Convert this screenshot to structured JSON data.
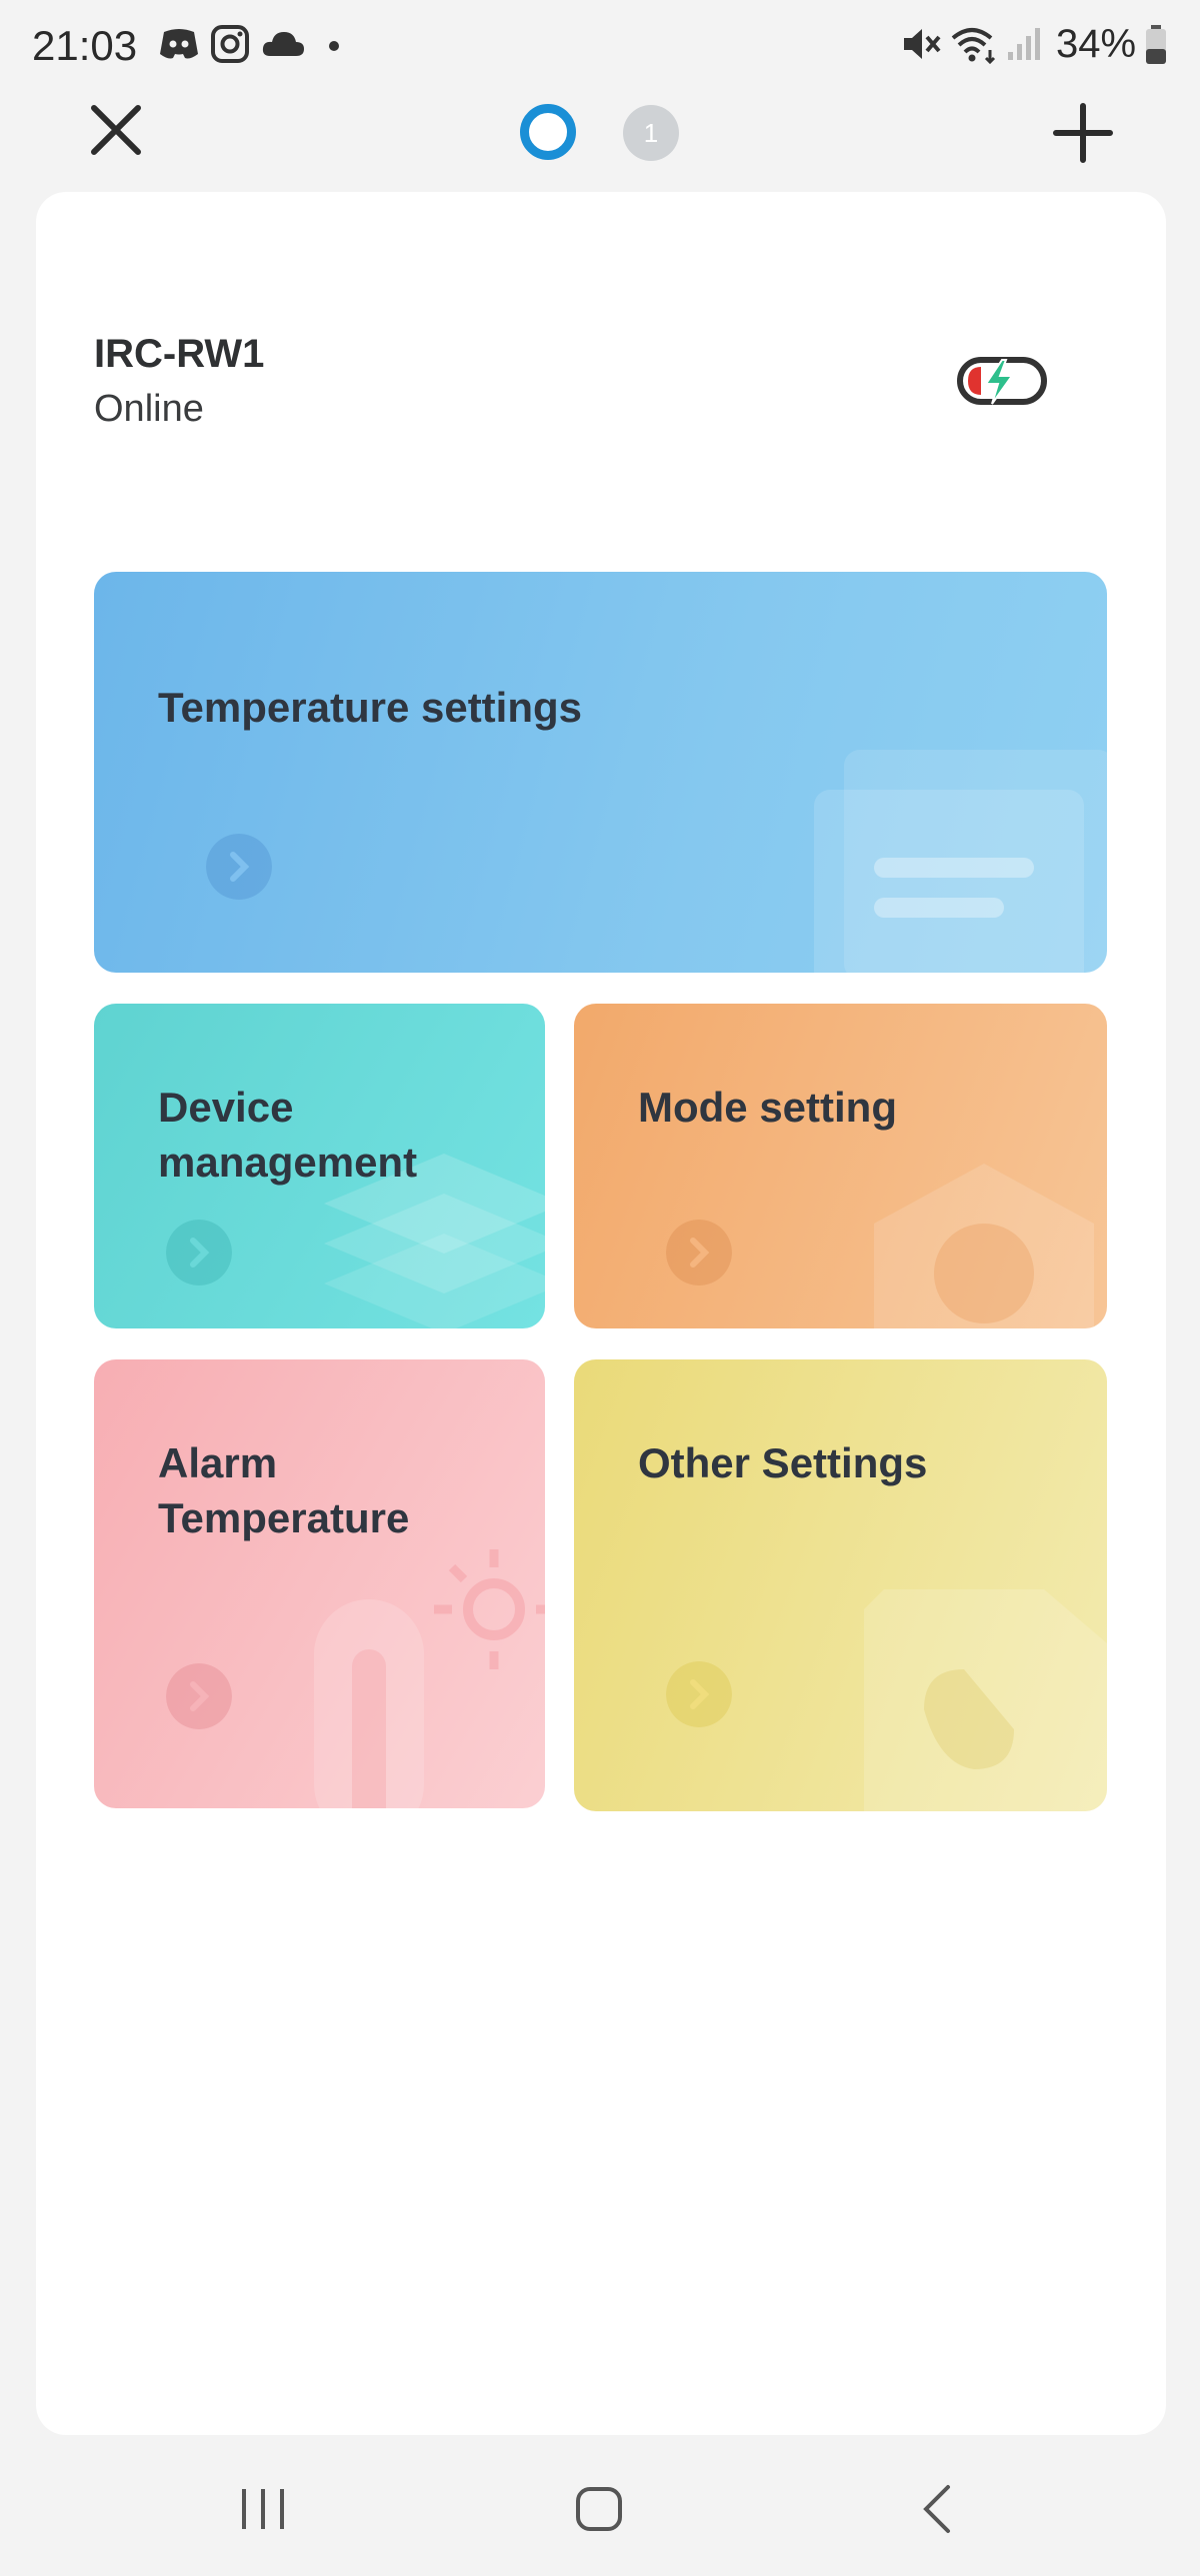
{
  "status_bar": {
    "time": "21:03",
    "battery_percent": "34%",
    "icons": [
      "discord-icon",
      "instagram-icon",
      "cloud-icon",
      "notification-dot-icon",
      "mute-icon",
      "wifi-icon",
      "signal-icon",
      "battery-icon"
    ]
  },
  "header": {
    "page_indicator_badge": "1"
  },
  "device": {
    "name": "IRC-RW1",
    "status": "Online"
  },
  "tiles": [
    {
      "label": "Temperature settings",
      "color": "#6cb6ea"
    },
    {
      "label": "Device management",
      "color": "#5fd3d1"
    },
    {
      "label": "Mode setting",
      "color": "#f2a96b"
    },
    {
      "label": "Alarm Temperature",
      "color": "#f7aeb3"
    },
    {
      "label": "Other Settings",
      "color": "#eada79"
    }
  ],
  "nav": {
    "buttons": [
      "recent-apps",
      "home",
      "back"
    ]
  },
  "colors": {
    "accent": "#1a8fd6",
    "battery_low": "#e0332f",
    "charging": "#2ebf8c"
  }
}
